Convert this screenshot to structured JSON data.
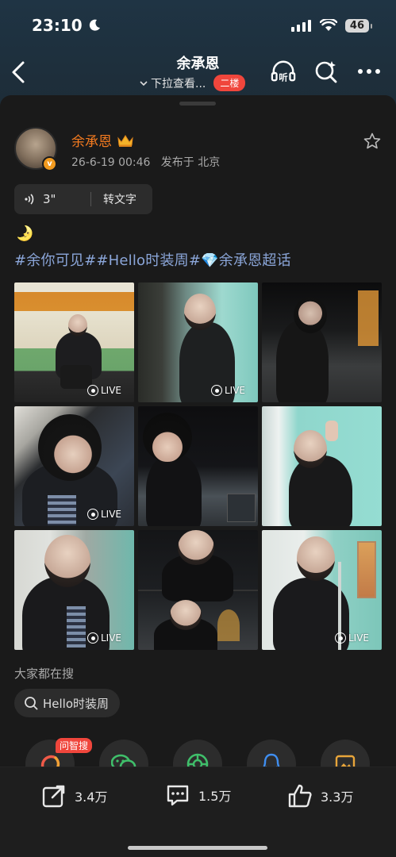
{
  "status_bar": {
    "time": "23:10",
    "battery": "46"
  },
  "nav": {
    "title": "余承恩",
    "subtitle": "下拉查看...",
    "floor_badge": "二楼",
    "listen_icon_label": "听"
  },
  "post": {
    "author": "余承恩",
    "date": "26-6-19 00:46",
    "location": "发布于 北京",
    "voice_duration": "3\"",
    "voice_transcribe": "转文字",
    "emoji": "🌛",
    "hashtags": "#余你可见##Hello时装周#💎余承恩超话",
    "photos": [
      {
        "live": true,
        "live_label": "LIVE",
        "scene": "station-bench"
      },
      {
        "live": true,
        "live_label": "LIVE",
        "scene": "teal-doorway"
      },
      {
        "live": true,
        "live_label": "LIVE",
        "scene": "night-street"
      },
      {
        "live": true,
        "live_label": "LIVE",
        "scene": "closeup-hair"
      },
      {
        "live": false,
        "live_label": "",
        "scene": "lean-car"
      },
      {
        "live": false,
        "live_label": "",
        "scene": "teal-wall-pose"
      },
      {
        "live": true,
        "live_label": "LIVE",
        "scene": "train-interior"
      },
      {
        "live": false,
        "live_label": "",
        "scene": "collage-night"
      },
      {
        "live": true,
        "live_label": "LIVE",
        "scene": "train-pole"
      }
    ]
  },
  "search": {
    "heading": "大家都在搜",
    "chip": "Hello时装周"
  },
  "share_row": {
    "ai_badge": "问智搜",
    "items": [
      "ai-search-icon",
      "wechat-icon",
      "moments-icon",
      "qq-icon",
      "image-save-icon"
    ]
  },
  "actions": {
    "repost": "3.4万",
    "comment": "1.5万",
    "like": "3.3万"
  },
  "colors": {
    "accent_orange": "#f47b20",
    "hashtag_blue": "#8ba6d9",
    "badge_red": "#f0463c",
    "sheet_bg": "#1a1a1a"
  }
}
